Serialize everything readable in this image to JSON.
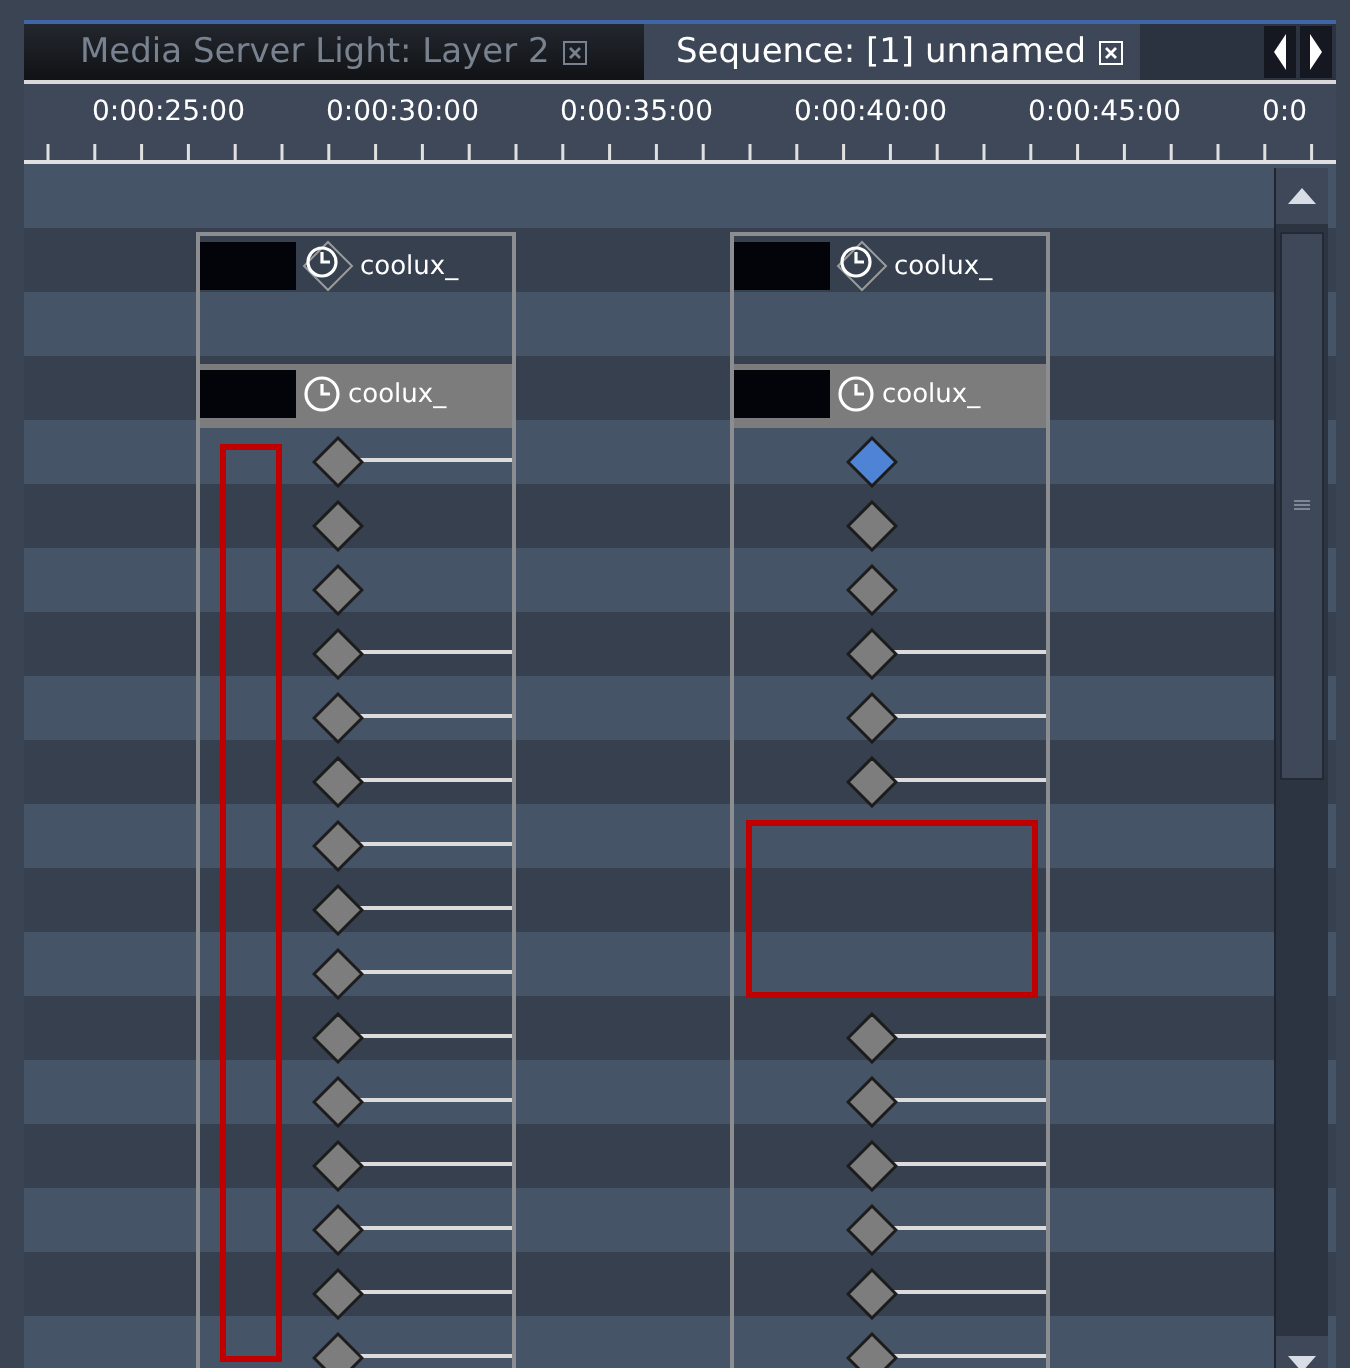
{
  "tabs": [
    {
      "label": "Media Server Light: Layer 2",
      "selected": false
    },
    {
      "label": "Sequence: [1] unnamed",
      "selected": true
    }
  ],
  "ruler": {
    "labels": [
      "0:00:25:00",
      "0:00:30:00",
      "0:00:35:00",
      "0:00:40:00",
      "0:00:45:00",
      "0:0"
    ]
  },
  "tracks": [
    {
      "clips": [
        {
          "label": "coolux_",
          "selected": false,
          "kind": "keyed"
        },
        {
          "label": "coolux_",
          "selected": true,
          "kind": "plain"
        }
      ],
      "annotation": {
        "kind": "strip"
      },
      "keyframes": [
        {
          "kind": "key",
          "selected": false,
          "line": true
        },
        {
          "kind": "key",
          "selected": false,
          "line": false
        },
        {
          "kind": "key",
          "selected": false,
          "line": false
        },
        {
          "kind": "key",
          "selected": false,
          "line": true
        },
        {
          "kind": "key",
          "selected": false,
          "line": true
        },
        {
          "kind": "key",
          "selected": false,
          "line": true
        },
        {
          "kind": "key",
          "selected": false,
          "line": true
        },
        {
          "kind": "key",
          "selected": false,
          "line": true
        },
        {
          "kind": "key",
          "selected": false,
          "line": true
        },
        {
          "kind": "key",
          "selected": false,
          "line": true
        },
        {
          "kind": "key",
          "selected": false,
          "line": true
        },
        {
          "kind": "key",
          "selected": false,
          "line": true
        },
        {
          "kind": "key",
          "selected": false,
          "line": true
        },
        {
          "kind": "key",
          "selected": false,
          "line": true
        },
        {
          "kind": "key",
          "selected": false,
          "line": true
        }
      ]
    },
    {
      "clips": [
        {
          "label": "coolux_",
          "selected": false,
          "kind": "keyed"
        },
        {
          "label": "coolux_",
          "selected": true,
          "kind": "plain"
        }
      ],
      "annotation": {
        "kind": "gap"
      },
      "keyframes": [
        {
          "kind": "key",
          "selected": true,
          "line": false
        },
        {
          "kind": "key",
          "selected": false,
          "line": false
        },
        {
          "kind": "key",
          "selected": false,
          "line": false
        },
        {
          "kind": "key",
          "selected": false,
          "line": true
        },
        {
          "kind": "key",
          "selected": false,
          "line": true
        },
        {
          "kind": "key",
          "selected": false,
          "line": true
        },
        {
          "kind": "none"
        },
        {
          "kind": "none"
        },
        {
          "kind": "none"
        },
        {
          "kind": "key",
          "selected": false,
          "line": true
        },
        {
          "kind": "key",
          "selected": false,
          "line": true
        },
        {
          "kind": "key",
          "selected": false,
          "line": true
        },
        {
          "kind": "key",
          "selected": false,
          "line": true
        },
        {
          "kind": "key",
          "selected": false,
          "line": true
        },
        {
          "kind": "key",
          "selected": false,
          "line": true
        }
      ]
    }
  ]
}
